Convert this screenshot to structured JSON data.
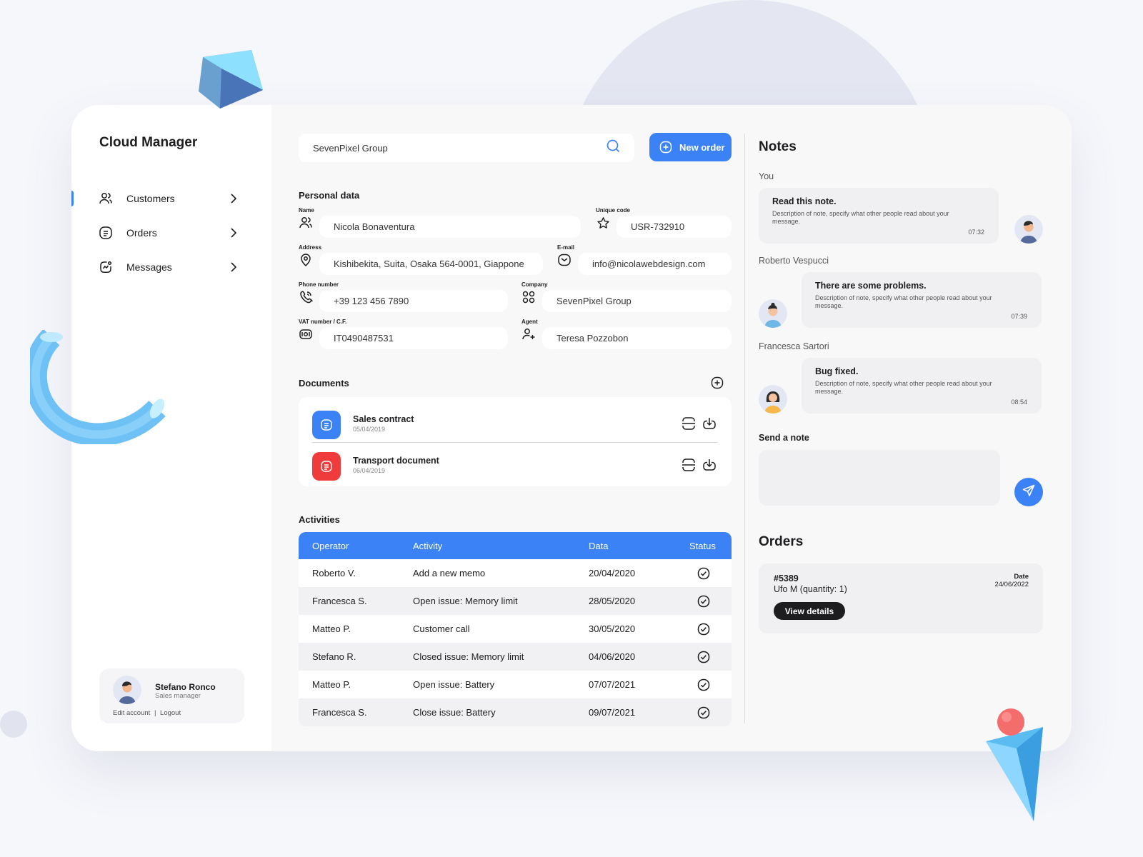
{
  "app": {
    "title": "Cloud Manager"
  },
  "sidebar": {
    "items": [
      {
        "label": "Customers",
        "icon": "users-icon"
      },
      {
        "label": "Orders",
        "icon": "document-list-icon"
      },
      {
        "label": "Messages",
        "icon": "activity-icon"
      }
    ],
    "user": {
      "name": "Stefano Ronco",
      "role": "Sales manager",
      "edit": "Edit account",
      "separator": "|",
      "logout": "Logout"
    }
  },
  "search": {
    "value": "SevenPixel Group"
  },
  "toolbar": {
    "new_order_label": "New order"
  },
  "personal": {
    "title": "Personal data",
    "fields": {
      "name": {
        "label": "Name",
        "value": "Nicola Bonaventura"
      },
      "code": {
        "label": "Unique code",
        "value": "USR-732910"
      },
      "address": {
        "label": "Address",
        "value": "Kishibekita, Suita, Osaka 564-0001, Giappone"
      },
      "email": {
        "label": "E-mail",
        "value": "info@nicolawebdesign.com"
      },
      "phone": {
        "label": "Phone number",
        "value": "+39 123 456 7890"
      },
      "company": {
        "label": "Company",
        "value": "SevenPixel Group"
      },
      "vat": {
        "label": "VAT number / C.F.",
        "value": "IT0490487531"
      },
      "agent": {
        "label": "Agent",
        "value": "Teresa Pozzobon"
      }
    }
  },
  "documents": {
    "title": "Documents",
    "items": [
      {
        "name": "Sales contract",
        "date": "05/04/2019",
        "color": "#3b82f6"
      },
      {
        "name": "Transport document",
        "date": "06/04/2019",
        "color": "#ef3b3b"
      }
    ]
  },
  "activities": {
    "title": "Activities",
    "headers": [
      "Operator",
      "Activity",
      "Data",
      "Status"
    ],
    "rows": [
      [
        "Roberto V.",
        "Add a new memo",
        "20/04/2020"
      ],
      [
        "Francesca S.",
        "Open issue: Memory limit",
        "28/05/2020"
      ],
      [
        "Matteo P.",
        "Customer call",
        "30/05/2020"
      ],
      [
        "Stefano R.",
        "Closed issue: Memory limit",
        "04/06/2020"
      ],
      [
        "Matteo P.",
        "Open issue: Battery",
        "07/07/2021"
      ],
      [
        "Francesca S.",
        "Close issue: Battery",
        "09/07/2021"
      ]
    ]
  },
  "notes": {
    "title": "Notes",
    "items": [
      {
        "author": "You",
        "title": "Read this note.",
        "desc": "Description of note, specify what other people read about your message.",
        "time": "07:32"
      },
      {
        "author": "Roberto Vespucci",
        "title": "There are some problems.",
        "desc": "Description of note, specify what other people read about your message.",
        "time": "07:39"
      },
      {
        "author": "Francesca Sartori",
        "title": "Bug fixed.",
        "desc": "Description of note, specify what other people read about your message.",
        "time": "08:54"
      }
    ],
    "send_label": "Send a note"
  },
  "orders": {
    "title": "Orders",
    "card": {
      "id": "#5389",
      "item": "Ufo M (quantity: 1)",
      "date_label": "Date",
      "date": "24/06/2022",
      "button": "View details"
    }
  },
  "colors": {
    "accent": "#3b82f6",
    "danger": "#ef3b3b",
    "dark": "#1d1d1f"
  }
}
